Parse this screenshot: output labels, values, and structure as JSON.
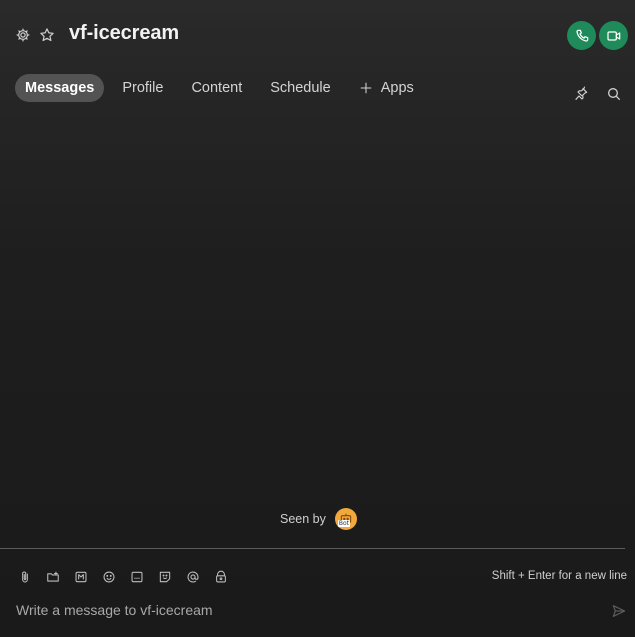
{
  "header": {
    "title": "vf-icecream",
    "icons": {
      "settings": "gear-icon",
      "favorite": "star-icon",
      "audio_call": "phone-icon",
      "video_call": "video-camera-icon"
    }
  },
  "tabs": [
    {
      "label": "Messages",
      "active": true
    },
    {
      "label": "Profile",
      "active": false
    },
    {
      "label": "Content",
      "active": false
    },
    {
      "label": "Schedule",
      "active": false
    },
    {
      "label": "Apps",
      "active": false,
      "icon": "plus-icon"
    }
  ],
  "toolbar": {
    "pin_icon": "pin-icon",
    "search_icon": "search-icon"
  },
  "seen_by": {
    "label": "Seen by",
    "avatar_tag": "Bot"
  },
  "composer": {
    "tools": [
      "paperclip-icon",
      "folder-icon",
      "markdown-icon",
      "emoji-icon",
      "gif-icon",
      "sticker-icon",
      "mention-icon",
      "lock-icon"
    ],
    "hint": "Shift + Enter for a new line",
    "placeholder": "Write a message to vf-icecream",
    "send_icon": "send-icon"
  },
  "colors": {
    "call_button": "#1f8a5a",
    "active_tab": "#535353",
    "avatar": "#f2a83a"
  }
}
